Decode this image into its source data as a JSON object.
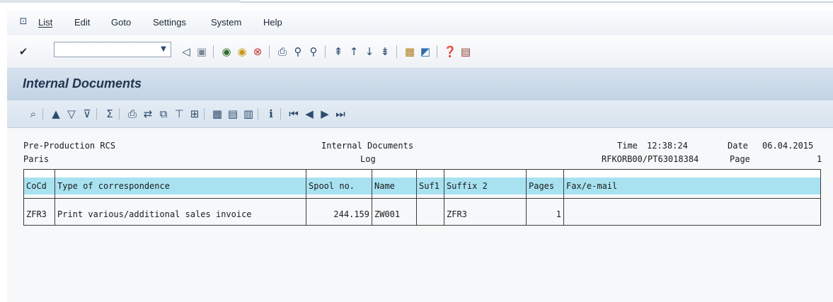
{
  "menu": {
    "items": [
      "List",
      "Edit",
      "Goto",
      "Settings",
      "System",
      "Help"
    ]
  },
  "toolbar": {
    "command_value": "",
    "icons": [
      "enter-icon",
      "back-icon",
      "save-icon",
      "navigate-back-icon",
      "exit-icon",
      "cancel-icon",
      "print-icon",
      "find-icon",
      "find-next-icon",
      "first-page-icon",
      "previous-page-icon",
      "next-page-icon",
      "last-page-icon",
      "create-session-icon",
      "shortcut-icon",
      "help-icon",
      "customize-layout-icon"
    ]
  },
  "page": {
    "title": "Internal Documents"
  },
  "report_header": {
    "left_line1": "Pre-Production RCS",
    "left_line2": "Paris",
    "center_line1": "Internal Documents",
    "center_line2": "Log",
    "time_label": "Time",
    "time_value": "12:38:24",
    "date_label": "Date",
    "date_value": "06.04.2015",
    "program": "RFKORB00/PT63018384",
    "page_label": "Page",
    "page_value": "1"
  },
  "table": {
    "headers": [
      "CoCd",
      "Type of correspondence",
      "Spool no.",
      "Name",
      "Suf1",
      "Suffix 2",
      "Pages",
      "Fax/e-mail"
    ],
    "rows": [
      [
        "ZFR3",
        "Print various/additional sales invoice",
        "244.159",
        "ZW001",
        "",
        "ZFR3",
        "1",
        ""
      ]
    ]
  },
  "colors": {
    "header_fill": "#a8e2f1",
    "title_band": "#c7d7e7"
  }
}
